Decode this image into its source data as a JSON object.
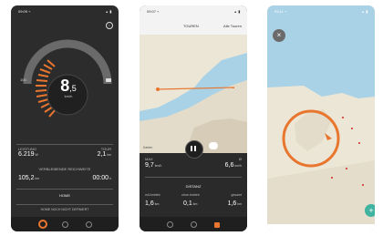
{
  "phone1": {
    "time": "09:09 ⌁",
    "status_icons": "▴ ▮",
    "info_icon": "info-icon",
    "speed_int": "8",
    "speed_dec": ",5",
    "speed_unit": "km/h",
    "battery_label": "100",
    "leistung_label": "LEISTUNG",
    "leistung_value": "6.219",
    "leistung_unit": "W",
    "tour_label": "TOUR",
    "tour_value": "2,1",
    "tour_unit": "km",
    "range_label": "VERBLEIBENDE REICHWEITE",
    "range_value": "105,2",
    "range_unit": "km",
    "range_time": "00:00",
    "range_time_unit": "h",
    "home_label": "HOME",
    "home_sub": "HOME NOCH NICHT DEFINIERT"
  },
  "phone2": {
    "time": "09:07 ⌁",
    "status_icons": "▴ ▮",
    "tab_touren": "TOUREN",
    "tab_alle": "Alle Touren",
    "map_credit": "Karten",
    "max_label": "MAX",
    "max_value": "9,7",
    "max_unit": "km/h",
    "right_label": "Ø",
    "right_value": "6,6",
    "right_unit": "km/h",
    "distanz_label": "DISTANZ",
    "col1_label": "mit Antrieb",
    "col1_value": "1,6",
    "col1_unit": "km",
    "col2_label": "ohne Antrieb",
    "col2_value": "0,1",
    "col2_unit": "km",
    "col3_label": "gesamt",
    "col3_value": "1,6",
    "col3_unit": "km"
  },
  "phone3": {
    "time": "09:11 ⌁",
    "status_icons": "▴ ▮",
    "close_icon": "close-icon",
    "add_icon": "plus-icon"
  },
  "colors": {
    "accent": "#e8762f",
    "dark_bg": "#2c2c2c",
    "bar": "#1f1f1f",
    "map_water": "#a9d2e7",
    "map_land": "#ece6d6",
    "fab": "#3fb3a0"
  }
}
